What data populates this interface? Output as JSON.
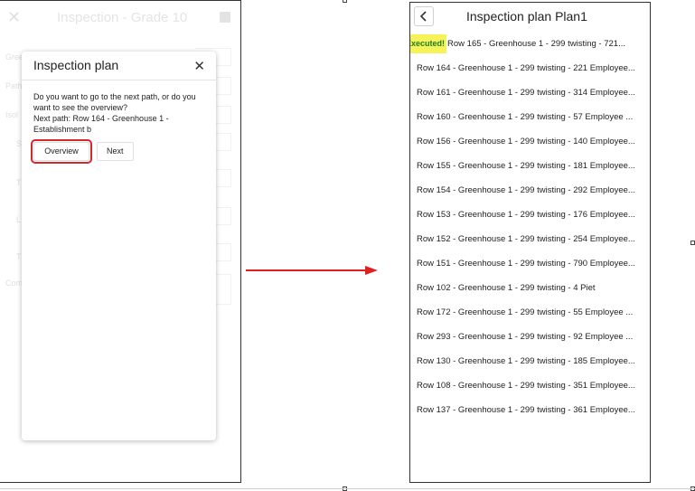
{
  "left_screen": {
    "background": {
      "title": "Inspection - Grade 10",
      "field_labels": [
        "Gree",
        "Path",
        "Isol",
        "S",
        "T",
        "L",
        "T",
        "Com"
      ]
    },
    "dialog": {
      "title": "Inspection plan",
      "message": "Do you want to go to the next path, or do you want to see the overview?",
      "next_path": "Next path: Row 164 - Greenhouse 1 - Establishment b",
      "overview_label": "Overview",
      "next_label": "Next"
    }
  },
  "right_screen": {
    "title": "Inspection plan Plan1",
    "executed_badge": "Executed!",
    "items": [
      "Row 165 - Greenhouse 1 - 299 twisting - 721...",
      "Row 164 - Greenhouse 1 - 299 twisting - 221 Employee...",
      "Row 161 - Greenhouse 1 - 299 twisting - 314 Employee...",
      "Row 160 - Greenhouse 1 - 299 twisting - 57 Employee ...",
      "Row 156 - Greenhouse 1 - 299 twisting - 140 Employee...",
      "Row 155 - Greenhouse 1 - 299 twisting - 181 Employee...",
      "Row 154 - Greenhouse 1 - 299 twisting - 292 Employee...",
      "Row 153 - Greenhouse 1 - 299 twisting - 176 Employee...",
      "Row 152 - Greenhouse 1 - 299 twisting - 254 Employee...",
      "Row 151 - Greenhouse 1 - 299 twisting - 790 Employee...",
      "Row 102 - Greenhouse 1 - 299 twisting - 4 Piet",
      "Row 172 - Greenhouse 1 - 299 twisting - 55 Employee ...",
      "Row 293 - Greenhouse 1 - 299 twisting - 92 Employee ...",
      "Row 130 - Greenhouse 1 - 299 twisting - 185 Employee...",
      "Row 108 - Greenhouse 1 - 299 twisting - 351 Employee...",
      "Row 137 - Greenhouse 1 - 299 twisting - 361 Employee..."
    ]
  },
  "colors": {
    "highlight_box": "#d8262a",
    "arrow": "#e02020",
    "badge_bg": "#f6f35a",
    "badge_text": "#1c7d24"
  },
  "icons": [
    "close-icon",
    "save-icon",
    "back-chevron-icon",
    "arrow-right-icon"
  ]
}
